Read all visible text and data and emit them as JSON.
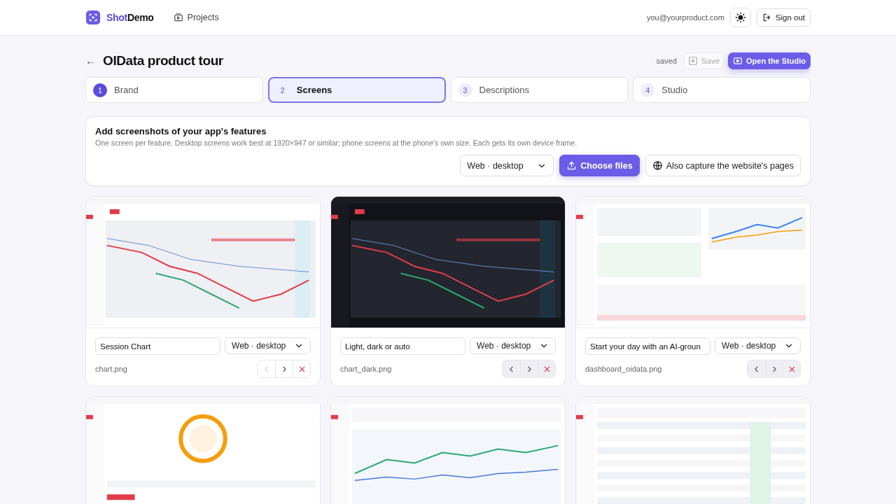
{
  "header": {
    "logo": {
      "first": "Shot",
      "second": "Demo"
    },
    "nav": [
      {
        "label": "Projects"
      }
    ],
    "email": "you@yourproduct.com",
    "sign_out": "Sign out"
  },
  "project": {
    "back": "←",
    "title": "OIData product tour",
    "status": "saved",
    "save": {
      "label": "Save",
      "disabled": true
    },
    "open": "Open the Studio"
  },
  "steps": [
    {
      "number": "1",
      "label": "Brand",
      "selected": false,
      "done": true
    },
    {
      "number": "2",
      "label": "Screens",
      "selected": true,
      "done": false
    },
    {
      "number": "3",
      "label": "Descriptions",
      "selected": false,
      "done": false
    },
    {
      "number": "4",
      "label": "Studio",
      "selected": false,
      "done": false
    }
  ],
  "upload": {
    "title": "Add screenshots of your app's features",
    "hint": "One screen per feature. Desktop screens work best at 1920×947 or similar; phone screens at the phone's own size. Each gets its own device frame.",
    "device": "Web · desktop",
    "choose": "Choose files",
    "capture": "Also capture the website's pages"
  },
  "screens": [
    {
      "kind": "picture",
      "caption": "Session Chart",
      "device": "Web · desktop",
      "file": "chart.png",
      "prev_disabled": true
    },
    {
      "kind": "picture",
      "caption": "Light, dark or auto",
      "device": "Web · desktop",
      "file": "chart_dark.png",
      "prev_disabled": false
    },
    {
      "kind": "picture",
      "caption": "Start your day with an AI-groun",
      "device": "Web · desktop",
      "file": "dashboard_oidata.png",
      "prev_disabled": false
    },
    {
      "kind": "picture"
    },
    {
      "kind": "picture"
    },
    {
      "kind": "picture"
    }
  ]
}
